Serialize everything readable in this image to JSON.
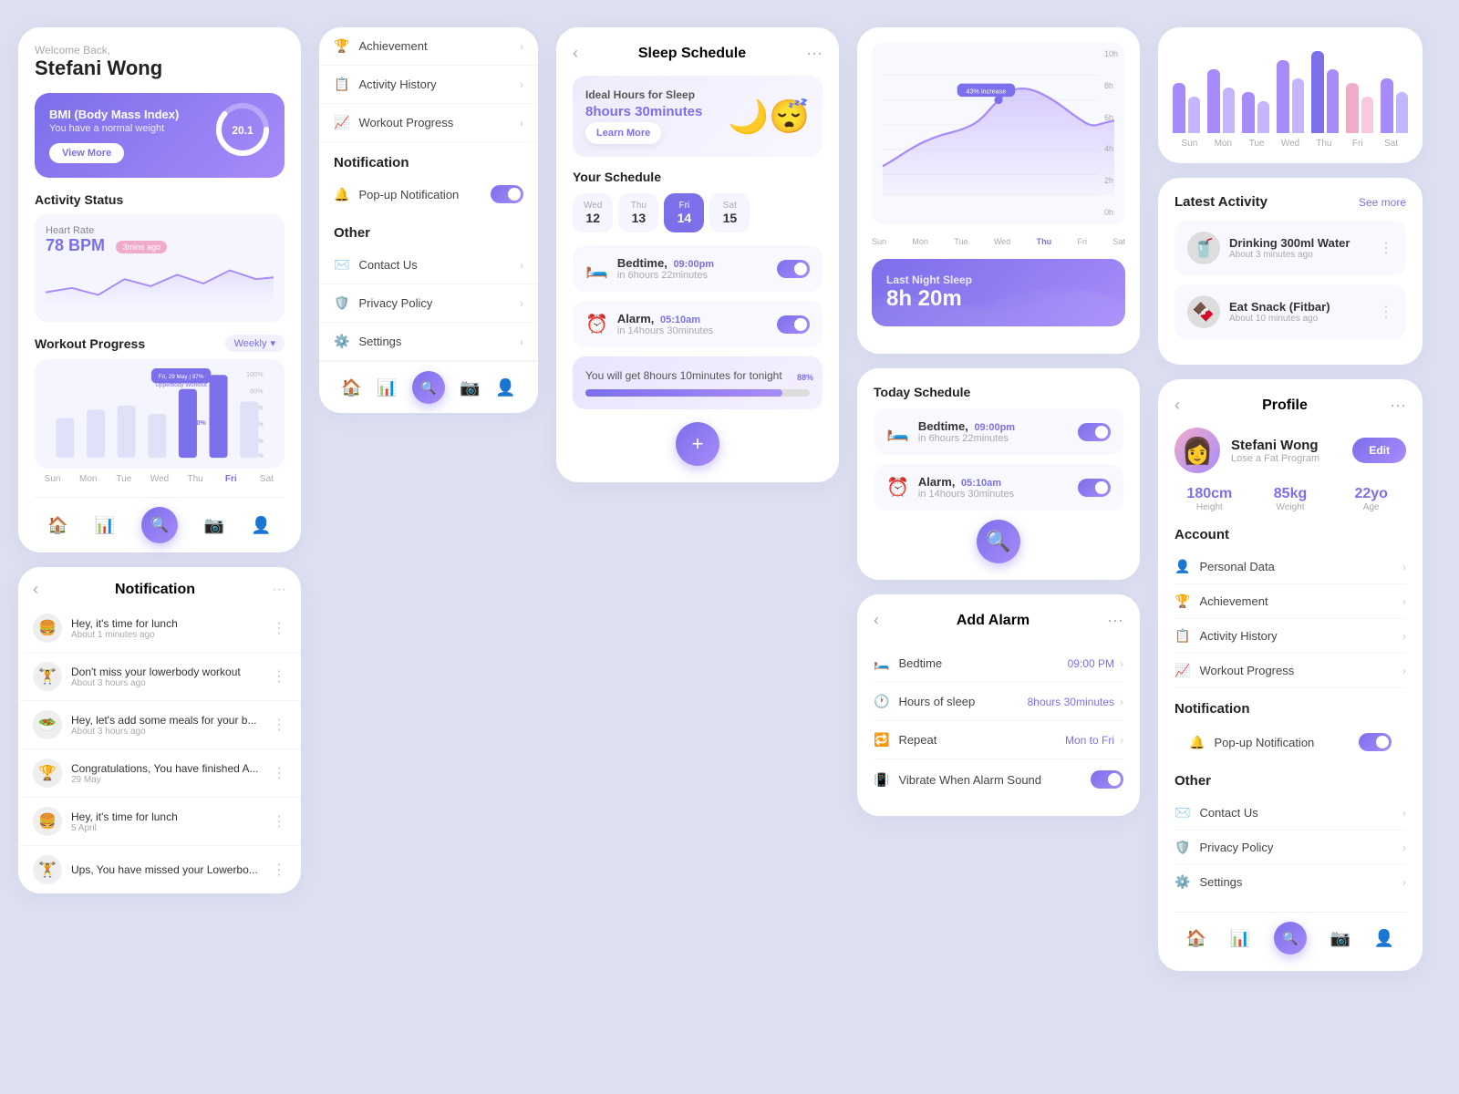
{
  "app": {
    "title": "Workout Progress"
  },
  "user": {
    "welcome": "Welcome Back,",
    "name": "Stefani Wong",
    "program": "Lose a Fat Program"
  },
  "bmi": {
    "title": "BMI (Body Mass Index)",
    "subtitle": "You have a normal weight",
    "value": "20.1",
    "button": "View More"
  },
  "activity": {
    "section_title": "Activity Status",
    "heart_rate_label": "Heart Rate",
    "heart_rate_value": "78 BPM",
    "heart_rate_badge": "3mins ago"
  },
  "workout": {
    "section_title": "Workout Progress",
    "filter": "Weekly",
    "bar_label": "Upperbody Workout",
    "bar_percent": "97%",
    "bar_date": "Fri, 29 May",
    "highlight_percent": "40%",
    "days": [
      "Sun",
      "Mon",
      "Tue",
      "Wed",
      "Thu",
      "Fri",
      "Sat"
    ],
    "active_day": "Fri",
    "pct_labels": [
      "100%",
      "80%",
      "60%",
      "40%",
      "20%",
      "0%"
    ]
  },
  "nav": {
    "home": "🏠",
    "chart": "📊",
    "search": "🔍",
    "camera": "📷",
    "profile": "👤"
  },
  "settings": {
    "achievement": "Achievement",
    "activity_history": "Activity History",
    "workout_progress": "Workout Progress",
    "notification_title": "Notification",
    "popup_notification": "Pop-up Notification",
    "other_title": "Other",
    "contact_us": "Contact Us",
    "privacy_policy": "Privacy Policy",
    "settings": "Settings"
  },
  "sleep_schedule": {
    "title": "Sleep Schedule",
    "ideal_title": "Ideal Hours for Sleep",
    "ideal_time": "8hours 30minutes",
    "learn_more": "Learn More",
    "schedule_title": "Your Schedule",
    "days": [
      {
        "day": "Wed",
        "num": "12"
      },
      {
        "day": "Thu",
        "num": "13"
      },
      {
        "day": "Fri",
        "num": "14",
        "active": true
      },
      {
        "day": "Sat",
        "num": "15"
      }
    ],
    "bedtime_label": "Bedtime,",
    "bedtime_time": "09:00pm",
    "bedtime_in": "in 6hours 22minutes",
    "alarm_label": "Alarm,",
    "alarm_time": "05:10am",
    "alarm_in": "in 14hours 30minutes",
    "tonight_msg": "You will get 8hours 10minutes for tonight",
    "tonight_pct": "88%"
  },
  "sleep_chart": {
    "annotation": "43% increase",
    "y_labels": [
      "10h",
      "8h",
      "6h",
      "4h",
      "2h",
      "0h"
    ],
    "x_labels": [
      "Sun",
      "Mon",
      "Tue",
      "Wed",
      "Thu",
      "Fri",
      "Sat"
    ],
    "active_x": "Thu",
    "last_sleep_label": "Last Night Sleep",
    "last_sleep_value": "8h 20m"
  },
  "today_schedule": {
    "title": "Today Schedule",
    "bedtime": {
      "label": "Bedtime,",
      "time": "09:00pm",
      "sub": "in 6hours 22minutes"
    },
    "alarm": {
      "label": "Alarm,",
      "time": "05:10am",
      "sub": "in 14hours 30minutes"
    }
  },
  "add_alarm": {
    "title": "Add Alarm",
    "bedtime_label": "Bedtime",
    "bedtime_value": "09:00 PM",
    "sleep_label": "Hours of sleep",
    "sleep_value": "8hours 30minutes",
    "repeat_label": "Repeat",
    "repeat_value": "Mon to Fri",
    "vibrate_label": "Vibrate When Alarm Sound"
  },
  "bar_chart": {
    "days": [
      "Sun",
      "Mon",
      "Tue",
      "Wed",
      "Thu",
      "Fri",
      "Sat"
    ],
    "bars": [
      {
        "h1": 55,
        "h2": 40,
        "c1": "#a78bfa",
        "c2": "#c4b5fd"
      },
      {
        "h1": 70,
        "h2": 50,
        "c1": "#a78bfa",
        "c2": "#c4b5fd"
      },
      {
        "h1": 45,
        "h2": 35,
        "c1": "#a78bfa",
        "c2": "#c4b5fd"
      },
      {
        "h1": 80,
        "h2": 60,
        "c1": "#a78bfa",
        "c2": "#c4b5fd"
      },
      {
        "h1": 90,
        "h2": 70,
        "c1": "#7c6fea",
        "c2": "#a78bfa"
      },
      {
        "h1": 55,
        "h2": 40,
        "c1": "#f0abcb",
        "c2": "#f9c8de"
      },
      {
        "h1": 60,
        "h2": 45,
        "c1": "#a78bfa",
        "c2": "#c4b5fd"
      }
    ]
  },
  "latest_activity": {
    "title": "Latest Activity",
    "see_more": "See more",
    "items": [
      {
        "emoji": "🥤",
        "title": "Drinking 300ml Water",
        "time": "About 3 minutes ago"
      },
      {
        "emoji": "🍫",
        "title": "Eat Snack (Fitbar)",
        "time": "About 10 minutes ago"
      }
    ]
  },
  "profile": {
    "title": "Profile",
    "name": "Stefani Wong",
    "program": "Lose a Fat Program",
    "edit_btn": "Edit",
    "height_val": "180cm",
    "height_lbl": "Height",
    "weight_val": "85kg",
    "weight_lbl": "Weight",
    "age_val": "22yo",
    "age_lbl": "Age",
    "account_title": "Account",
    "personal_data": "Personal Data",
    "achievement": "Achievement",
    "activity_history": "Activity History",
    "workout_progress": "Workout Progress",
    "notification_title": "Notification",
    "popup_notification": "Pop-up Notification",
    "other_title": "Other",
    "contact_us": "Contact Us",
    "privacy_policy": "Privacy Policy",
    "settings": "Settings"
  },
  "notification_card": {
    "title": "Notification",
    "items": [
      {
        "emoji": "🍔",
        "text": "Hey, it's time for lunch",
        "time": "About 1 minutes ago"
      },
      {
        "emoji": "🏋️",
        "text": "Don't miss your lowerbody workout",
        "time": "About 3 hours ago"
      },
      {
        "emoji": "🥗",
        "text": "Hey, let's add some meals for your b...",
        "time": "About 3 hours ago"
      },
      {
        "emoji": "🏆",
        "text": "Congratulations, You have finished A...",
        "time": "29 May"
      },
      {
        "emoji": "🍔",
        "text": "Hey, it's time for lunch",
        "time": "5 April"
      },
      {
        "emoji": "🏋️",
        "text": "Ups, You have missed your Lowerbo...",
        "time": ""
      }
    ]
  }
}
